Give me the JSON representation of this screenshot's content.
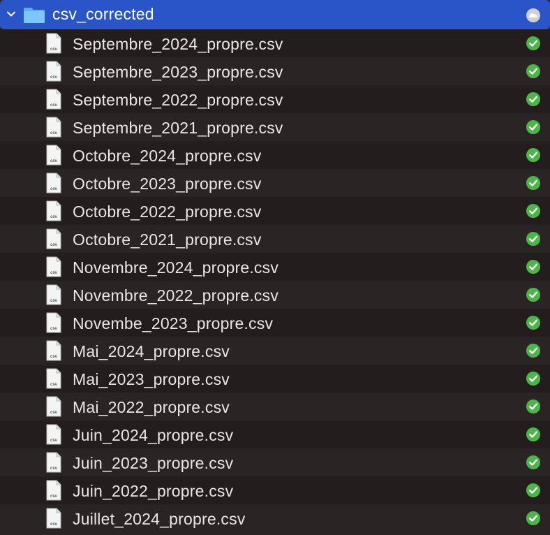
{
  "folder": {
    "name": "csv_corrected",
    "expanded": true,
    "sync_status_icon": "cloud-icon"
  },
  "colors": {
    "selection": "#2a55c8",
    "row_dark": "#231d1d",
    "row_light": "#2b2424",
    "check_green": "#4cb648",
    "text": "#ebe6e6"
  },
  "files": [
    {
      "name": "Septembre_2024_propre.csv",
      "status_icon": "check-icon"
    },
    {
      "name": "Septembre_2023_propre.csv",
      "status_icon": "check-icon"
    },
    {
      "name": "Septembre_2022_propre.csv",
      "status_icon": "check-icon"
    },
    {
      "name": "Septembre_2021_propre.csv",
      "status_icon": "check-icon"
    },
    {
      "name": "Octobre_2024_propre.csv",
      "status_icon": "check-icon"
    },
    {
      "name": "Octobre_2023_propre.csv",
      "status_icon": "check-icon"
    },
    {
      "name": "Octobre_2022_propre.csv",
      "status_icon": "check-icon"
    },
    {
      "name": "Octobre_2021_propre.csv",
      "status_icon": "check-icon"
    },
    {
      "name": "Novembre_2024_propre.csv",
      "status_icon": "check-icon"
    },
    {
      "name": "Novembre_2022_propre.csv",
      "status_icon": "check-icon"
    },
    {
      "name": "Novembe_2023_propre.csv",
      "status_icon": "check-icon"
    },
    {
      "name": "Mai_2024_propre.csv",
      "status_icon": "check-icon"
    },
    {
      "name": "Mai_2023_propre.csv",
      "status_icon": "check-icon"
    },
    {
      "name": "Mai_2022_propre.csv",
      "status_icon": "check-icon"
    },
    {
      "name": "Juin_2024_propre.csv",
      "status_icon": "check-icon"
    },
    {
      "name": "Juin_2023_propre.csv",
      "status_icon": "check-icon"
    },
    {
      "name": "Juin_2022_propre.csv",
      "status_icon": "check-icon"
    },
    {
      "name": "Juillet_2024_propre.csv",
      "status_icon": "check-icon"
    }
  ],
  "file_icon_label": "csv"
}
